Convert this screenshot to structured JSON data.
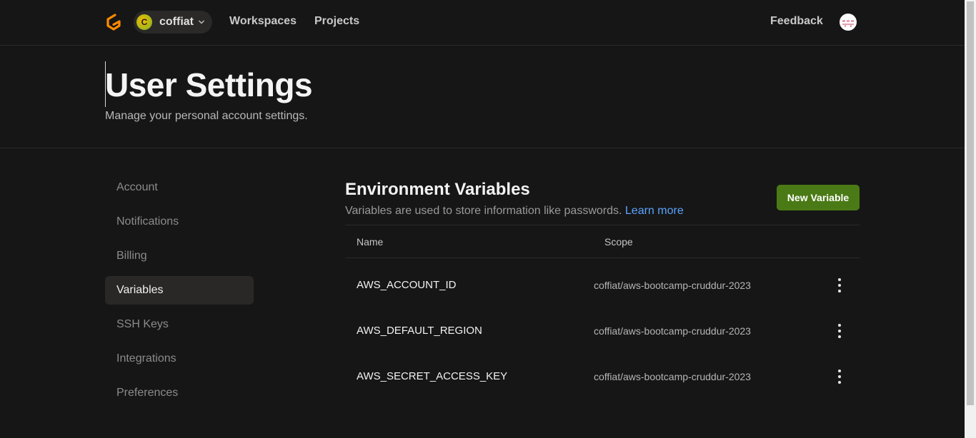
{
  "nav": {
    "org_initial": "C",
    "org_name": "coffiat",
    "links": [
      "Workspaces",
      "Projects"
    ],
    "feedback": "Feedback"
  },
  "header": {
    "title": "User Settings",
    "subtitle": "Manage your personal account settings."
  },
  "sidebar": {
    "items": [
      {
        "label": "Account"
      },
      {
        "label": "Notifications"
      },
      {
        "label": "Billing"
      },
      {
        "label": "Variables"
      },
      {
        "label": "SSH Keys"
      },
      {
        "label": "Integrations"
      },
      {
        "label": "Preferences"
      }
    ],
    "active": "Variables"
  },
  "main": {
    "title": "Environment Variables",
    "description": "Variables are used to store information like passwords.",
    "learn_more": "Learn more",
    "new_button": "New Variable",
    "columns": [
      "Name",
      "Scope"
    ],
    "rows": [
      {
        "name": "AWS_ACCOUNT_ID",
        "scope": "coffiat/aws-bootcamp-cruddur-2023"
      },
      {
        "name": "AWS_DEFAULT_REGION",
        "scope": "coffiat/aws-bootcamp-cruddur-2023"
      },
      {
        "name": "AWS_SECRET_ACCESS_KEY",
        "scope": "coffiat/aws-bootcamp-cruddur-2023"
      }
    ]
  },
  "colors": {
    "accent_green": "#4a7a15",
    "link_blue": "#5ba3ff",
    "logo_orange": "#ff8a00"
  },
  "icons": [
    "gitpod-logo-icon",
    "chevron-down-icon",
    "user-avatar-icon",
    "more-vertical-icon"
  ]
}
